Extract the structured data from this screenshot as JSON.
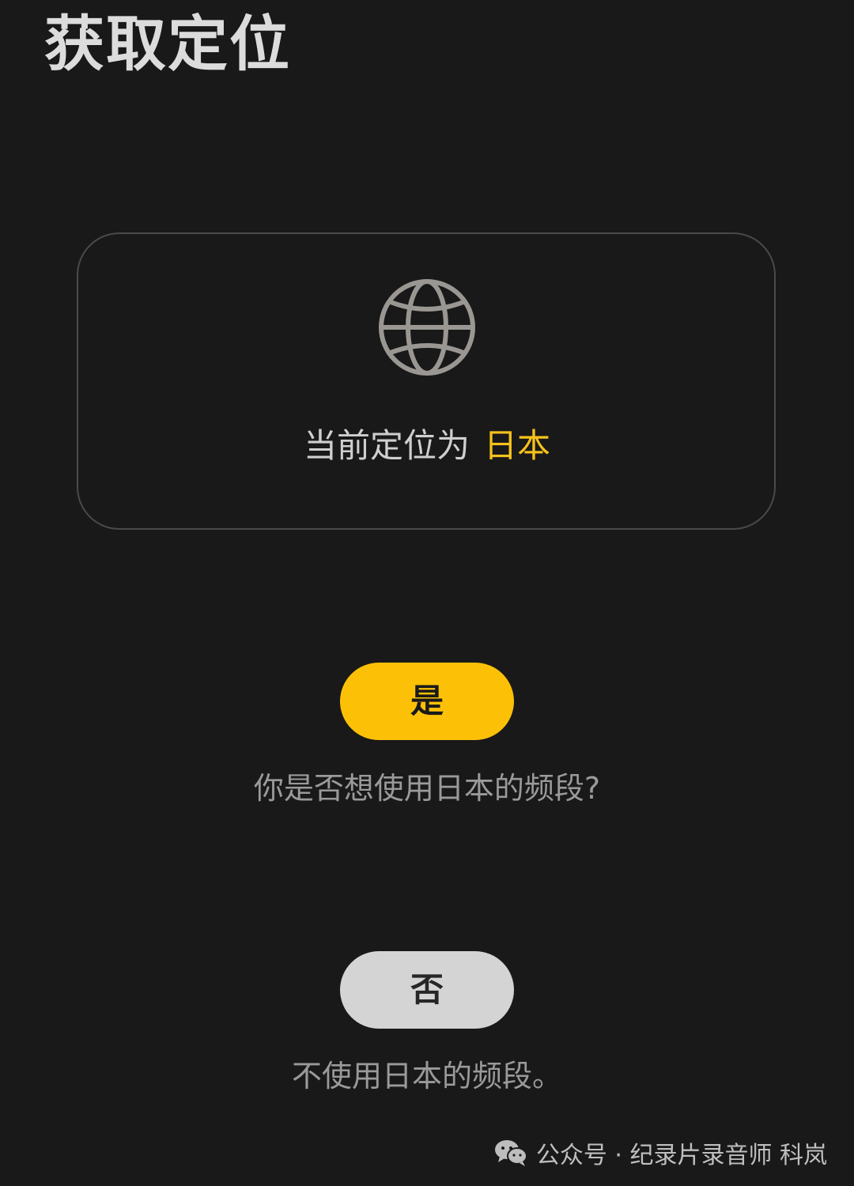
{
  "header": {
    "title": "获取定位"
  },
  "location_card": {
    "icon": "globe-icon",
    "prefix": "当前定位为",
    "value": "日本",
    "value_color": "#f7c21c"
  },
  "actions": {
    "yes_label": "是",
    "yes_description": "你是否想使用日本的频段?",
    "no_label": "否",
    "no_description": "不使用日本的频段。"
  },
  "watermark": {
    "icon": "wechat-icon",
    "text": "公众号 · 纪录片录音师 科岚"
  },
  "colors": {
    "background": "#191919",
    "accent": "#fcc107",
    "secondary_button": "#d4d4d4"
  }
}
